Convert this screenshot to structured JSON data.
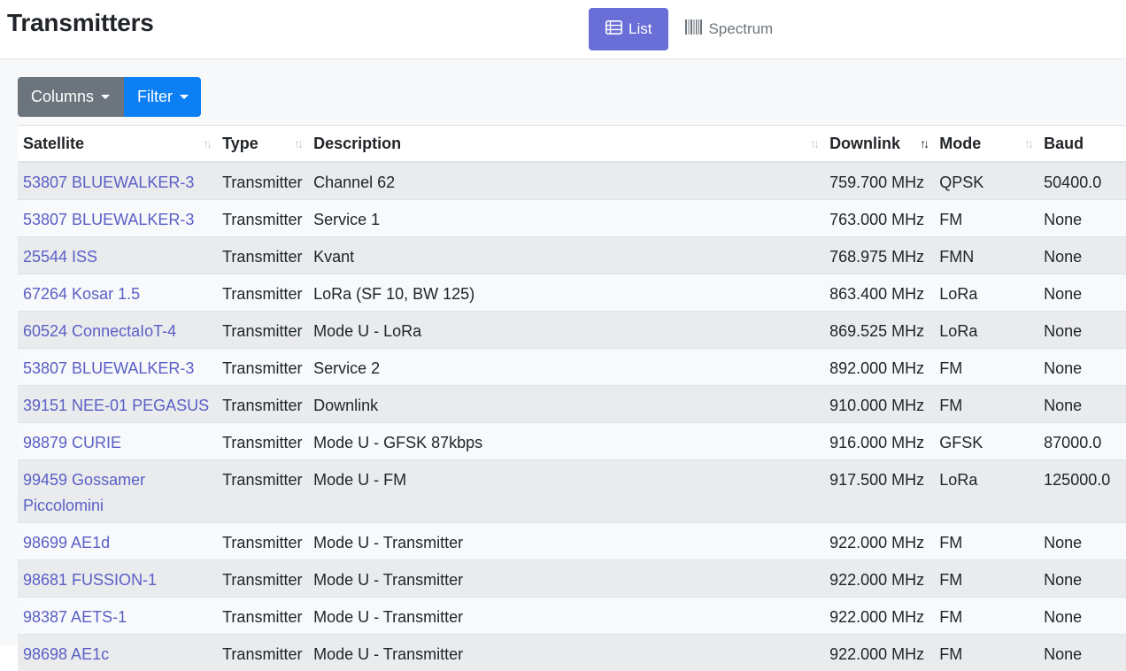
{
  "header": {
    "title": "Transmitters",
    "views": [
      {
        "label": "List",
        "icon": "list-icon",
        "active": true
      },
      {
        "label": "Spectrum",
        "icon": "barcode-icon",
        "active": false
      }
    ]
  },
  "toolbar": {
    "columns_label": "Columns",
    "filter_label": "Filter"
  },
  "colors": {
    "accent": "#6a6fd8",
    "filter": "#0d7ff5",
    "columns": "#6c757d",
    "link": "#5a5fc6"
  },
  "table": {
    "columns": [
      "Satellite",
      "Type",
      "Description",
      "Downlink",
      "Mode",
      "Baud"
    ],
    "sorted_column": "Downlink",
    "sort_direction": "ascending",
    "rows": [
      {
        "satellite": "53807 BLUEWALKER-3",
        "type": "Transmitter",
        "description": "Channel 62",
        "downlink": "759.700 MHz",
        "mode": "QPSK",
        "baud": "50400.0"
      },
      {
        "satellite": "53807 BLUEWALKER-3",
        "type": "Transmitter",
        "description": "Service 1",
        "downlink": "763.000 MHz",
        "mode": "FM",
        "baud": "None"
      },
      {
        "satellite": "25544 ISS",
        "type": "Transmitter",
        "description": "Kvant",
        "downlink": "768.975 MHz",
        "mode": "FMN",
        "baud": "None"
      },
      {
        "satellite": "67264 Kosar 1.5",
        "type": "Transmitter",
        "description": "LoRa (SF 10, BW 125)",
        "downlink": "863.400 MHz",
        "mode": "LoRa",
        "baud": "None"
      },
      {
        "satellite": "60524 ConnectaIoT-4",
        "type": "Transmitter",
        "description": "Mode U - LoRa",
        "downlink": "869.525 MHz",
        "mode": "LoRa",
        "baud": "None"
      },
      {
        "satellite": "53807 BLUEWALKER-3",
        "type": "Transmitter",
        "description": "Service 2",
        "downlink": "892.000 MHz",
        "mode": "FM",
        "baud": "None"
      },
      {
        "satellite": "39151 NEE-01 PEGASUS",
        "type": "Transmitter",
        "description": "Downlink",
        "downlink": "910.000 MHz",
        "mode": "FM",
        "baud": "None"
      },
      {
        "satellite": "98879 CURIE",
        "type": "Transmitter",
        "description": "Mode U - GFSK 87kbps",
        "downlink": "916.000 MHz",
        "mode": "GFSK",
        "baud": "87000.0"
      },
      {
        "satellite": "99459 Gossamer Piccolomini",
        "type": "Transmitter",
        "description": "Mode U - FM",
        "downlink": "917.500 MHz",
        "mode": "LoRa",
        "baud": "125000.0"
      },
      {
        "satellite": "98699 AE1d",
        "type": "Transmitter",
        "description": "Mode U - Transmitter",
        "downlink": "922.000 MHz",
        "mode": "FM",
        "baud": "None"
      },
      {
        "satellite": "98681 FUSSION-1",
        "type": "Transmitter",
        "description": "Mode U - Transmitter",
        "downlink": "922.000 MHz",
        "mode": "FM",
        "baud": "None"
      },
      {
        "satellite": "98387 AETS-1",
        "type": "Transmitter",
        "description": "Mode U - Transmitter",
        "downlink": "922.000 MHz",
        "mode": "FM",
        "baud": "None"
      },
      {
        "satellite": "98698 AE1c",
        "type": "Transmitter",
        "description": "Mode U - Transmitter",
        "downlink": "922.000 MHz",
        "mode": "FM",
        "baud": "None"
      }
    ]
  }
}
